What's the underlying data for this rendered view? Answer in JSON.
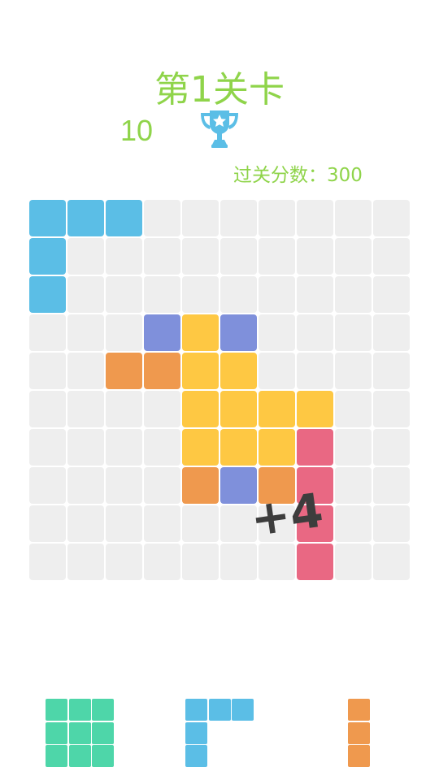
{
  "level_title": "第1关卡",
  "current_score": "10",
  "target_score_label": "过关分数：300",
  "combo_popup": "+4",
  "colors": {
    "empty": "#eeeeee",
    "blue": "#5bbee6",
    "purple": "#7f90db",
    "yellow": "#fec843",
    "orange": "#ef994e",
    "pink": "#e96883",
    "green": "#4ed6a9",
    "text_green": "#8fd44a",
    "trophy": "#5bbee6"
  },
  "board": {
    "rows": 10,
    "cols": 10,
    "cells": [
      [
        "blue",
        "blue",
        "blue",
        "",
        "",
        "",
        "",
        "",
        "",
        ""
      ],
      [
        "blue",
        "",
        "",
        "",
        "",
        "",
        "",
        "",
        "",
        ""
      ],
      [
        "blue",
        "",
        "",
        "",
        "",
        "",
        "",
        "",
        "",
        ""
      ],
      [
        "",
        "",
        "",
        "purple",
        "yellow",
        "purple",
        "",
        "",
        "",
        ""
      ],
      [
        "",
        "",
        "orange",
        "orange",
        "yellow",
        "yellow",
        "",
        "",
        "",
        ""
      ],
      [
        "",
        "",
        "",
        "",
        "yellow",
        "yellow",
        "yellow",
        "yellow",
        "",
        ""
      ],
      [
        "",
        "",
        "",
        "",
        "yellow",
        "yellow",
        "yellow",
        "pink",
        "",
        ""
      ],
      [
        "",
        "",
        "",
        "",
        "orange",
        "purple",
        "orange",
        "pink",
        "",
        ""
      ],
      [
        "",
        "",
        "",
        "",
        "",
        "",
        "",
        "pink",
        "",
        ""
      ],
      [
        "",
        "",
        "",
        "",
        "",
        "",
        "",
        "pink",
        "",
        ""
      ]
    ]
  },
  "tray": [
    {
      "name": "piece-green-square",
      "color": "green",
      "shape": [
        [
          1,
          1,
          1
        ],
        [
          1,
          1,
          1
        ],
        [
          1,
          1,
          1
        ]
      ]
    },
    {
      "name": "piece-blue-corner",
      "color": "blue",
      "shape": [
        [
          1,
          1,
          1
        ],
        [
          1,
          0,
          0
        ],
        [
          1,
          0,
          0
        ]
      ]
    },
    {
      "name": "piece-orange-bar",
      "color": "orange",
      "shape": [
        [
          1
        ],
        [
          1
        ],
        [
          1
        ]
      ]
    }
  ]
}
